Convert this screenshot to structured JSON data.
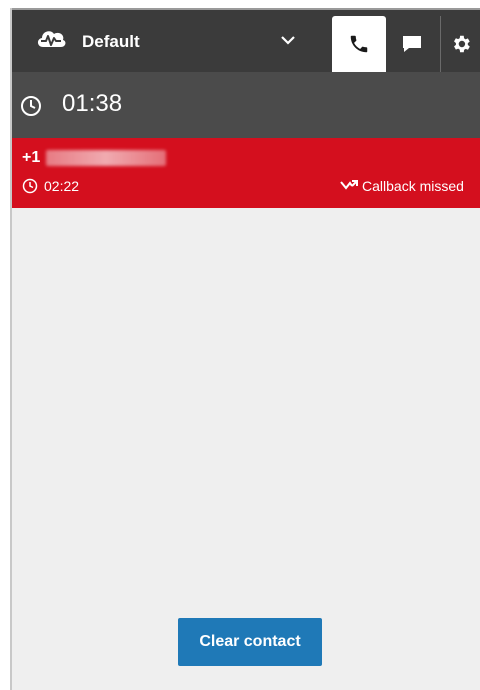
{
  "header": {
    "agent_status": "Default",
    "icons": {
      "status": "cloud-heartbeat-icon",
      "dropdown": "chevron-down-icon",
      "phone_tab": "phone-icon",
      "chat_tab": "chat-bubble-icon",
      "settings_tab": "gear-icon"
    },
    "active_tab": "phone"
  },
  "timer": {
    "value": "01:38",
    "icon": "clock-icon"
  },
  "contact": {
    "phone_prefix": "+1",
    "duration": "02:22",
    "status": "Callback missed",
    "status_icon": "missed-call-icon",
    "color": "#d40f1e"
  },
  "actions": {
    "clear_contact_label": "Clear contact"
  },
  "colors": {
    "header_bg": "#3b3b3b",
    "timer_bg": "#4b4b4b",
    "content_bg": "#efefef",
    "button_bg": "#1f79b7"
  }
}
